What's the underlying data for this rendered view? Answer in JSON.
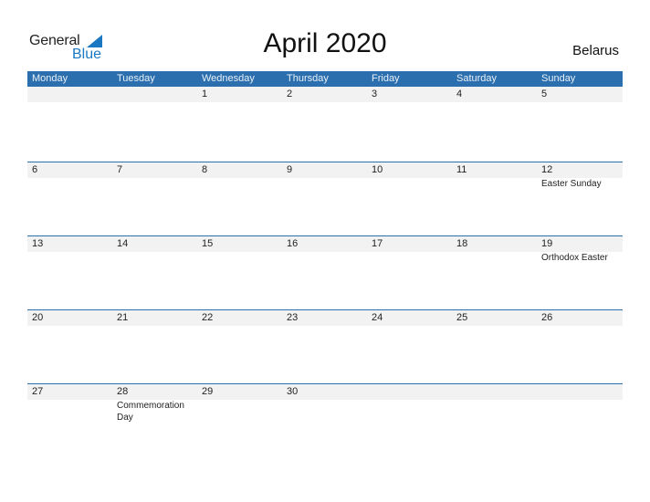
{
  "logo": {
    "line1": "General",
    "line2": "Blue"
  },
  "title": "April 2020",
  "country": "Belarus",
  "colors": {
    "accent": "#2c6faf",
    "logo_blue": "#1a78c2",
    "strip": "#f2f2f2"
  },
  "weekdays": [
    "Monday",
    "Tuesday",
    "Wednesday",
    "Thursday",
    "Friday",
    "Saturday",
    "Sunday"
  ],
  "weeks": [
    {
      "days": [
        "",
        "",
        "1",
        "2",
        "3",
        "4",
        "5"
      ],
      "holidays": [
        "",
        "",
        "",
        "",
        "",
        "",
        ""
      ]
    },
    {
      "days": [
        "6",
        "7",
        "8",
        "9",
        "10",
        "11",
        "12"
      ],
      "holidays": [
        "",
        "",
        "",
        "",
        "",
        "",
        "Easter Sunday"
      ]
    },
    {
      "days": [
        "13",
        "14",
        "15",
        "16",
        "17",
        "18",
        "19"
      ],
      "holidays": [
        "",
        "",
        "",
        "",
        "",
        "",
        "Orthodox Easter"
      ]
    },
    {
      "days": [
        "20",
        "21",
        "22",
        "23",
        "24",
        "25",
        "26"
      ],
      "holidays": [
        "",
        "",
        "",
        "",
        "",
        "",
        ""
      ]
    },
    {
      "days": [
        "27",
        "28",
        "29",
        "30",
        "",
        "",
        ""
      ],
      "holidays": [
        "",
        "Commemoration Day",
        "",
        "",
        "",
        "",
        ""
      ]
    }
  ]
}
